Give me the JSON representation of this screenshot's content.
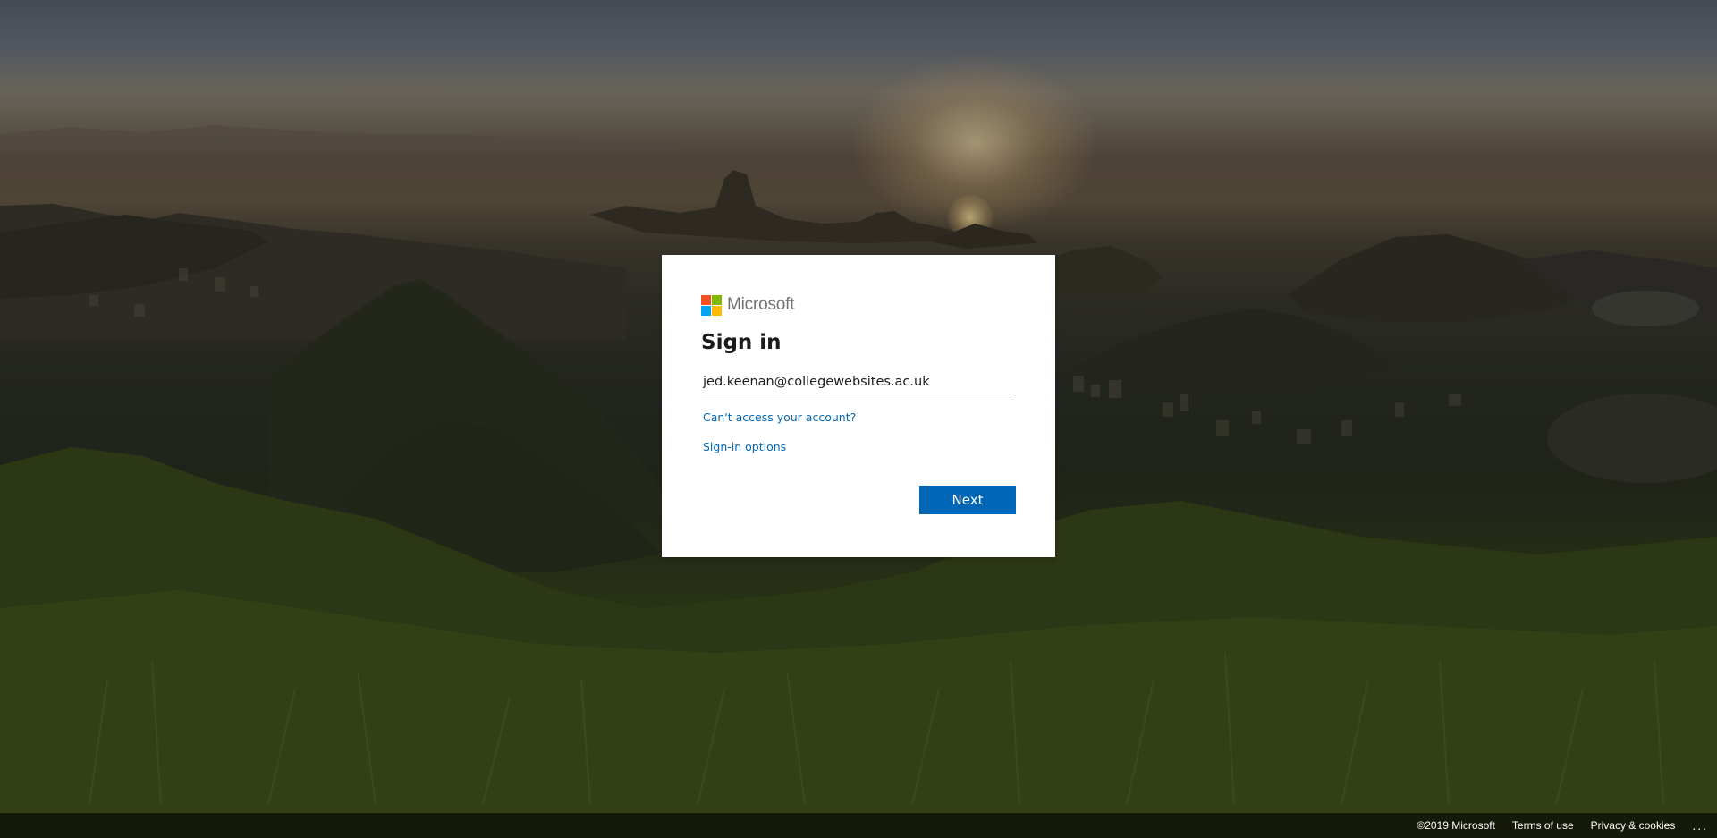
{
  "brand": {
    "name": "Microsoft",
    "logo_colors": [
      "#f25022",
      "#7fba00",
      "#00a4ef",
      "#ffb900"
    ]
  },
  "signin": {
    "title": "Sign in",
    "email_value": "jed.keenan@collegewebsites.ac.uk",
    "cant_access_link": "Can't access your account?",
    "signin_options_link": "Sign-in options",
    "next_button": "Next",
    "accent_color": "#0067b8"
  },
  "footer": {
    "copyright": "©2019 Microsoft",
    "terms": "Terms of use",
    "privacy": "Privacy & cookies",
    "more": "..."
  },
  "background": {
    "description_icon": "landscape-photo"
  }
}
